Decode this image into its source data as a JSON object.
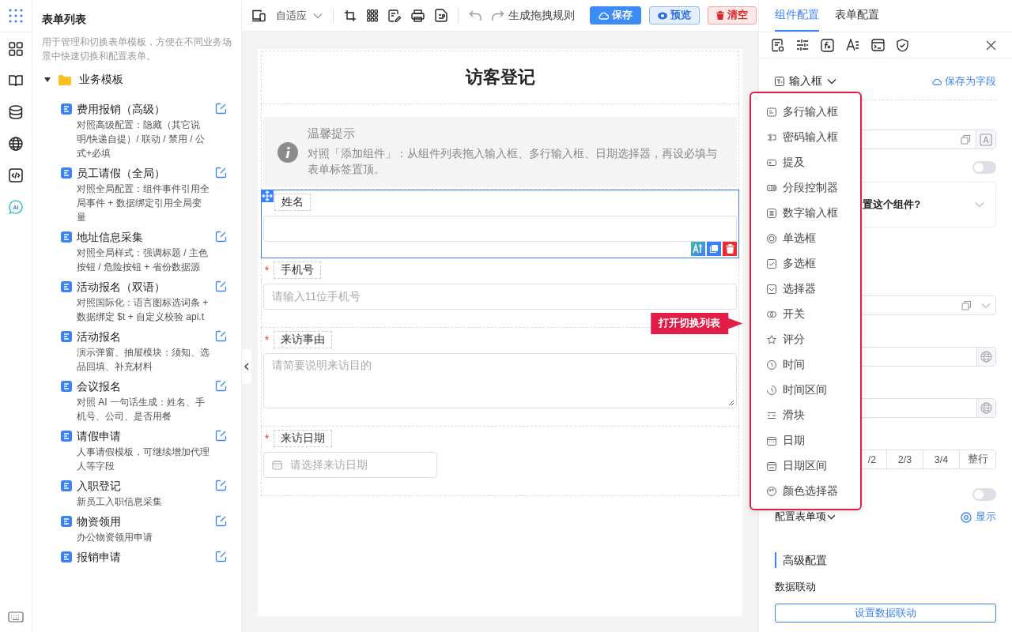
{
  "rail": {
    "ai_label": "AI"
  },
  "sidebar": {
    "title": "表单列表",
    "description": "用于管理和切换表单模板，方便在不同业务场景中快速切换和配置表单。",
    "folder": {
      "label": "业务模板",
      "expanded": true,
      "items": [
        {
          "title": "费用报销（高级）",
          "description": "对照高级配置：隐藏（其它说明/快递自提）/ 联动 / 禁用 / 公式+必填"
        },
        {
          "title": "员工请假（全局）",
          "description": "对照全局配置：组件事件引用全局事件 + 数据绑定引用全局变量"
        },
        {
          "title": "地址信息采集",
          "description": "对照全局样式：强调标题 / 主色按钮 / 危险按钮 + 省份数据源"
        },
        {
          "title": "活动报名（双语）",
          "description": "对照国际化：语言图标选词条 + 数据绑定 $t + 自定义校验 api.t"
        },
        {
          "title": "活动报名",
          "description": "演示弹窗、抽屉模块：须知、选品回填、补充材料"
        },
        {
          "title": "会议报名",
          "description": "对照 AI 一句话生成：姓名、手机号、公司、是否用餐"
        },
        {
          "title": "请假申请",
          "description": "人事请假模板，可继续增加代理人等字段"
        },
        {
          "title": "入职登记",
          "description": "新员工入职信息采集"
        },
        {
          "title": "物资领用",
          "description": "办公物资领用申请"
        },
        {
          "title": "报销申请"
        }
      ]
    }
  },
  "toolbar": {
    "layout_mode": "自适应",
    "rule_link": "生成拖拽规则",
    "buttons": [
      {
        "label": "保存",
        "kind": "primary"
      },
      {
        "label": "预览",
        "kind": "preview"
      },
      {
        "label": "清空",
        "kind": "danger"
      }
    ]
  },
  "form": {
    "title": "访客登记",
    "notice": {
      "title": "温馨提示",
      "text": "对照「添加组件」：从组件列表拖入输入框、多行输入框、日期选择器，再设必填与表单标签置顶。"
    },
    "fields": [
      {
        "label": "姓名",
        "kind": "input",
        "selected": true
      },
      {
        "label": "手机号",
        "kind": "input",
        "required_mark": "*",
        "selected": false,
        "placeholder": "请输入11位手机号"
      },
      {
        "label": "来访事由",
        "kind": "textarea",
        "required_mark": "*",
        "selected": false,
        "placeholder": "请简要说明来访目的"
      },
      {
        "label": "来访日期",
        "kind": "date",
        "required_mark": "*",
        "selected": false,
        "placeholder": "请选择来访日期"
      }
    ]
  },
  "tooltip": "打开切换列表",
  "panel": {
    "tabs": [
      {
        "label": "组件配置",
        "selected": true
      },
      {
        "label": "表单配置",
        "selected": false
      }
    ],
    "component_type": "输入框",
    "save_field": "保存为字段",
    "question": "置这个组件?",
    "toggles": [
      {
        "on": false
      },
      {
        "on": false
      }
    ],
    "width_options": [
      "/2",
      "2/3",
      "3/4",
      "整行"
    ],
    "config_items": "配置表单项",
    "show_link": "显示",
    "advanced_title": "高级配置",
    "linkage_label": "数据联动",
    "linkage_button": "设置数据联动",
    "switch_list": [
      {
        "label": "多行输入框",
        "kind": "textarea"
      },
      {
        "label": "密码输入框",
        "kind": "password"
      },
      {
        "label": "提及",
        "kind": "mention"
      },
      {
        "label": "分段控制器",
        "kind": "segmented"
      },
      {
        "label": "数字输入框",
        "kind": "number"
      },
      {
        "label": "单选框",
        "kind": "radio"
      },
      {
        "label": "多选框",
        "kind": "checkbox"
      },
      {
        "label": "选择器",
        "kind": "select"
      },
      {
        "label": "开关",
        "kind": "switch"
      },
      {
        "label": "评分",
        "kind": "rate"
      },
      {
        "label": "时间",
        "kind": "time"
      },
      {
        "label": "时间区间",
        "kind": "timerange"
      },
      {
        "label": "滑块",
        "kind": "slider"
      },
      {
        "label": "日期",
        "kind": "date"
      },
      {
        "label": "日期区间",
        "kind": "daterange"
      },
      {
        "label": "颜色选择器",
        "kind": "color"
      }
    ]
  }
}
